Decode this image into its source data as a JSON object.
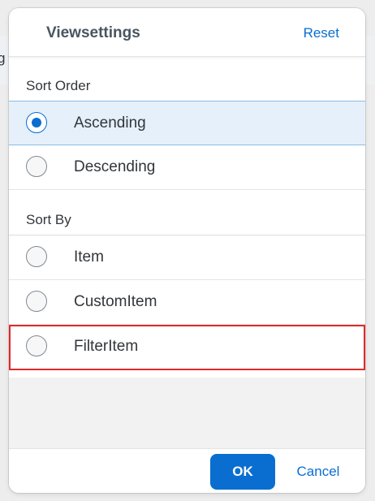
{
  "background": {
    "fragment": "g"
  },
  "dialog": {
    "title": "Viewsettings",
    "reset_label": "Reset",
    "sort_order": {
      "label": "Sort Order",
      "options": [
        {
          "label": "Ascending",
          "selected": true
        },
        {
          "label": "Descending",
          "selected": false
        }
      ]
    },
    "sort_by": {
      "label": "Sort By",
      "options": [
        {
          "label": "Item",
          "selected": false
        },
        {
          "label": "CustomItem",
          "selected": false
        },
        {
          "label": "FilterItem",
          "selected": false,
          "focused": true
        }
      ]
    },
    "footer": {
      "ok_label": "OK",
      "cancel_label": "Cancel"
    }
  },
  "colors": {
    "accent": "#0a6ed1",
    "selected_row": "#e5f0fa",
    "focus_outline": "#e12a2a"
  }
}
